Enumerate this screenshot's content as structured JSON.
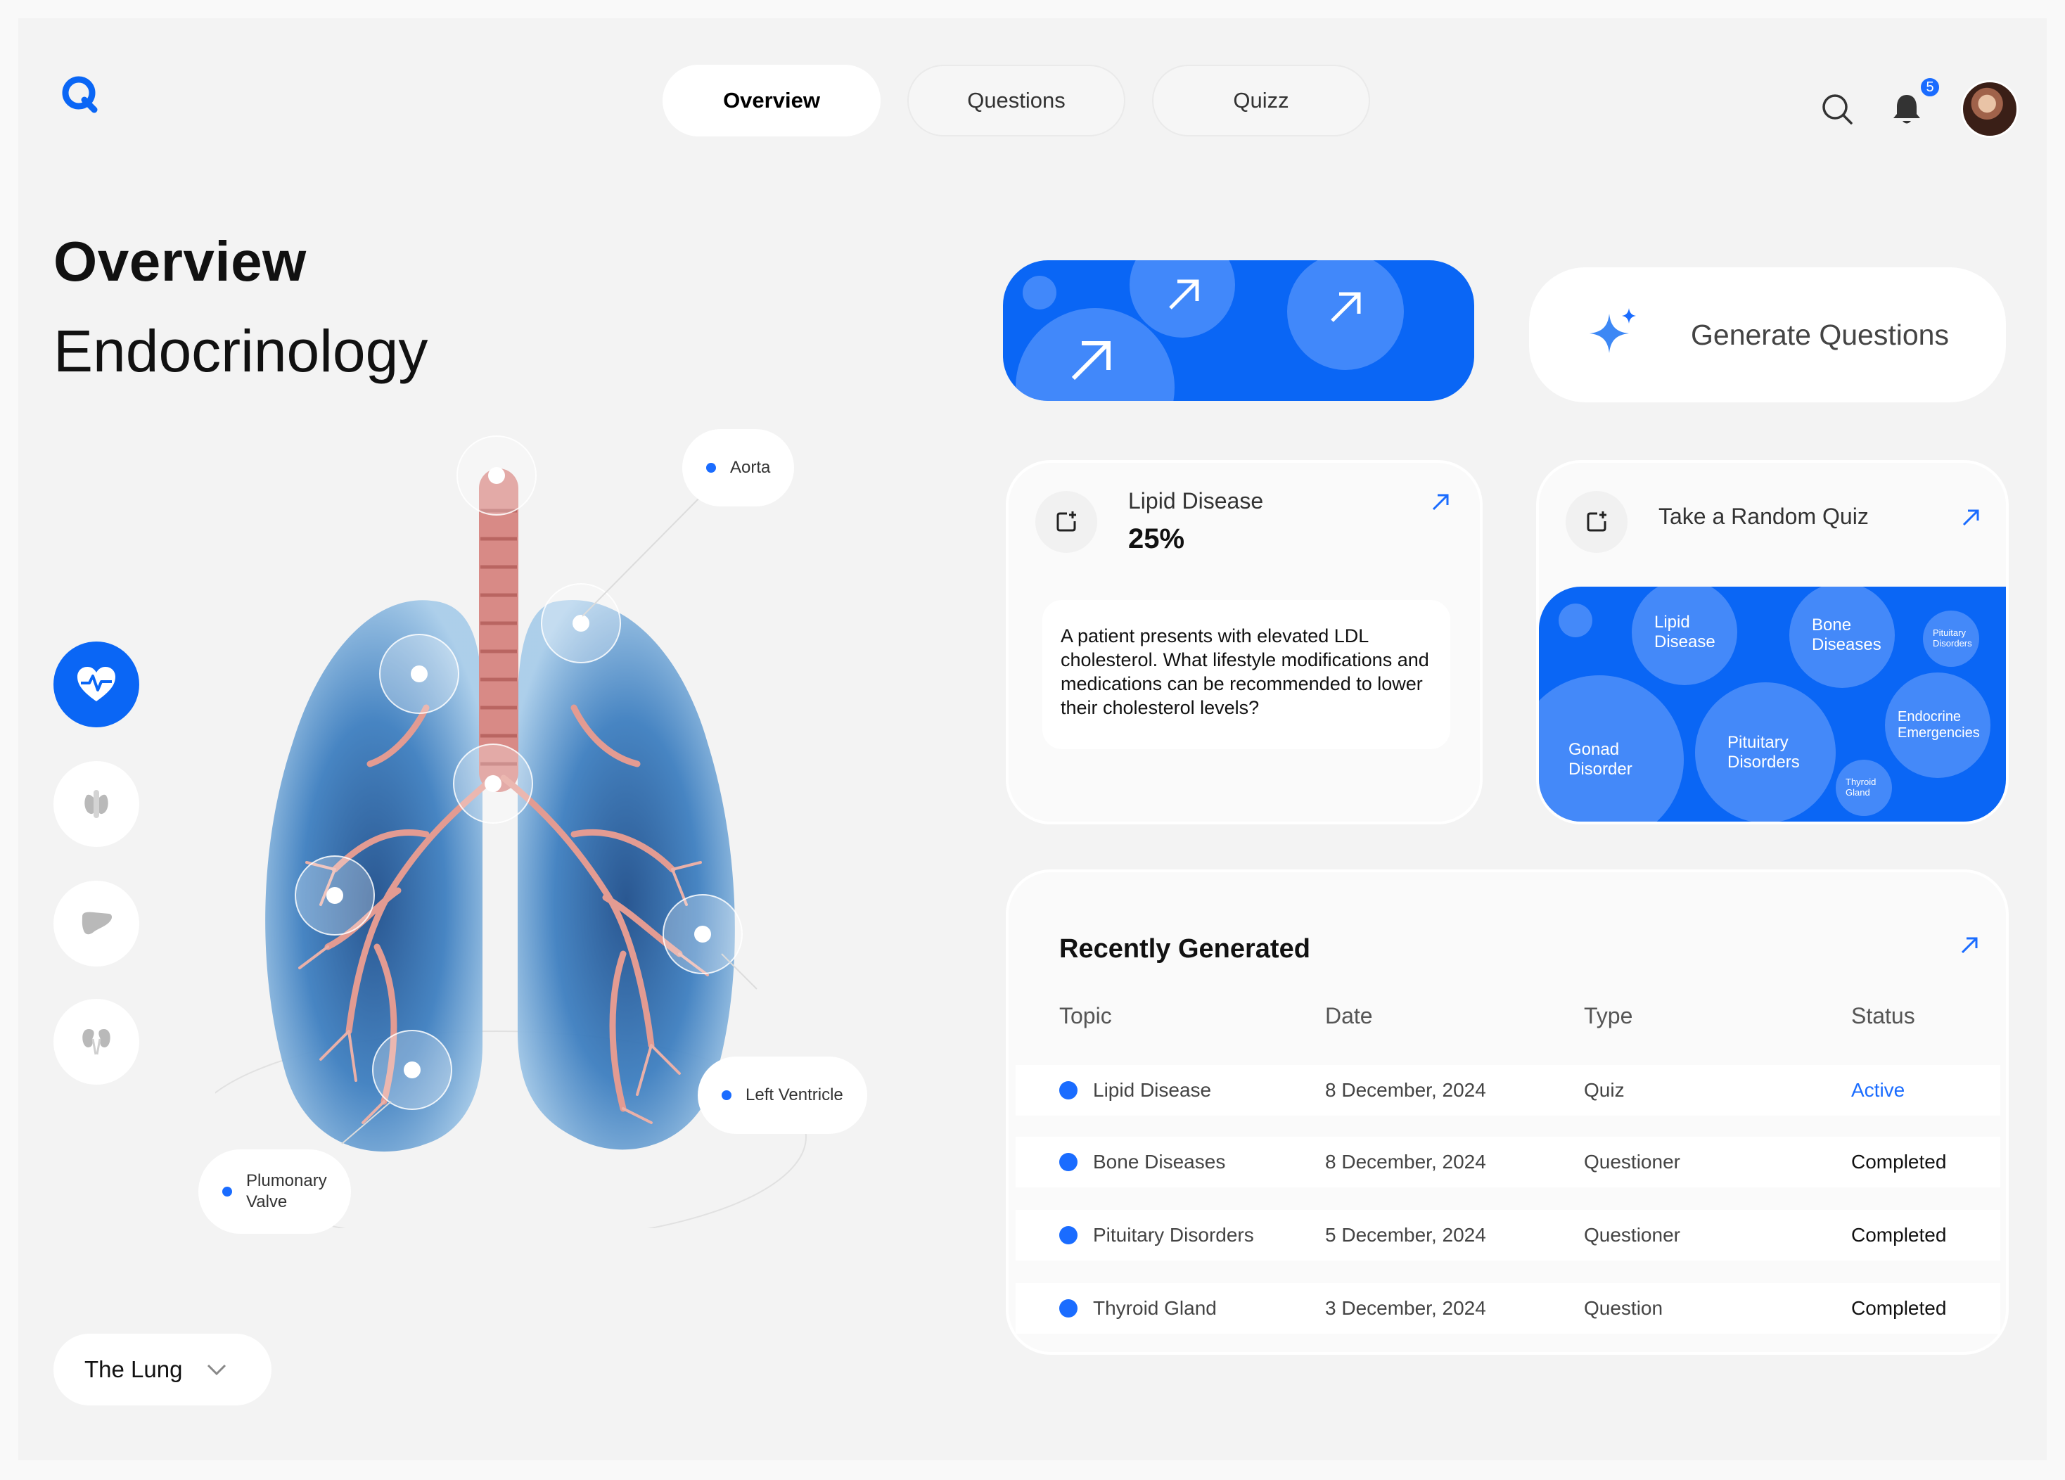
{
  "header": {
    "logo_letter": "Q",
    "tabs": [
      {
        "label": "Overview",
        "active": true
      },
      {
        "label": "Questions",
        "active": false
      },
      {
        "label": "Quizz",
        "active": false
      }
    ],
    "notification_count": "5"
  },
  "page": {
    "title": "Overview",
    "subtitle": "Endocrinology"
  },
  "organ_rail": [
    {
      "icon": "heart-pulse-icon",
      "active": true
    },
    {
      "icon": "thyroid-icon",
      "active": false
    },
    {
      "icon": "liver-icon",
      "active": false
    },
    {
      "icon": "kidneys-icon",
      "active": false
    }
  ],
  "anatomy_labels": {
    "aorta": "Aorta",
    "left_ventricle": "Left Ventricle",
    "pulmonary_valve_line1": "Plumonary",
    "pulmonary_valve_line2": "Valve"
  },
  "organ_select": {
    "value": "The Lung"
  },
  "generate": {
    "label": "Generate Questions"
  },
  "lipid_card": {
    "topic": "Lipid Disease",
    "percent": "25%",
    "question": "A patient presents with elevated LDL cholesterol. What lifestyle modifications and medications can be recommended to lower their cholesterol levels?"
  },
  "quiz_card": {
    "title": "Take a Random Quiz",
    "bubbles": [
      {
        "line1": "Lipid",
        "line2": "Disease"
      },
      {
        "line1": "Bone",
        "line2": "Diseases"
      },
      {
        "line1": "Pituitary",
        "line2": "Disorders"
      },
      {
        "line1": "Gonad",
        "line2": "Disorder"
      },
      {
        "line1": "Pituitary",
        "line2": "Disorders"
      },
      {
        "line1": "Endocrine",
        "line2": "Emergencies"
      },
      {
        "line1": "Thyroid",
        "line2": "Gland"
      }
    ]
  },
  "recent": {
    "title": "Recently Generated",
    "columns": [
      "Topic",
      "Date",
      "Type",
      "Status"
    ],
    "rows": [
      {
        "topic": "Lipid Disease",
        "date": "8 December, 2024",
        "type": "Quiz",
        "status": "Active"
      },
      {
        "topic": "Bone Diseases",
        "date": "8 December, 2024",
        "type": "Questioner",
        "status": "Completed"
      },
      {
        "topic": "Pituitary Disorders",
        "date": "5 December, 2024",
        "type": "Questioner",
        "status": "Completed"
      },
      {
        "topic": "Thyroid Gland",
        "date": "3 December, 2024",
        "type": "Question",
        "status": "Completed"
      }
    ]
  },
  "colors": {
    "accent": "#0a66f5",
    "active_status": "#1a6cff",
    "background": "#f3f3f3"
  }
}
